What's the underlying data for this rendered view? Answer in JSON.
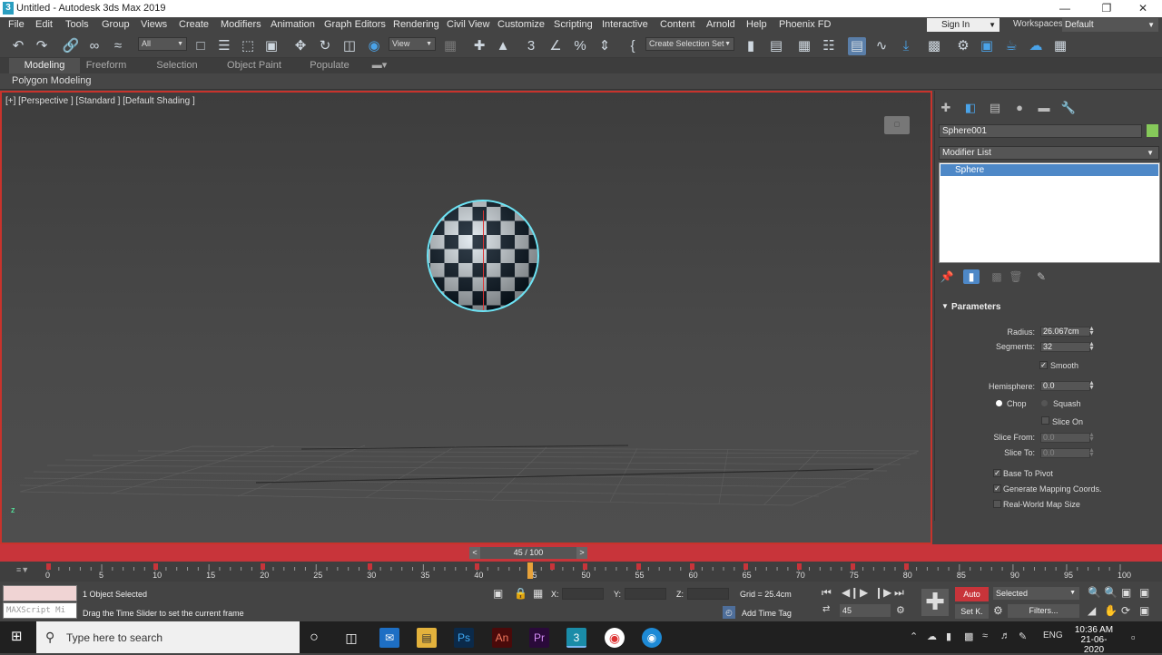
{
  "window": {
    "title": "Untitled - Autodesk 3ds Max 2019",
    "app_icon_letter": "3"
  },
  "menu": {
    "items": [
      "File",
      "Edit",
      "Tools",
      "Group",
      "Views",
      "Create",
      "Modifiers",
      "Animation",
      "Graph Editors",
      "Rendering",
      "Civil View",
      "Customize",
      "Scripting",
      "Interactive",
      "Content",
      "Arnold",
      "Help",
      "Phoenix FD"
    ],
    "sign_in": "Sign In",
    "workspaces_label": "Workspaces:",
    "workspace_value": "Default"
  },
  "toolbar": {
    "selection_filter": "All",
    "ref_coord": "View",
    "named_selection": "Create Selection Set"
  },
  "ribbon": {
    "tabs": [
      "Modeling",
      "Freeform",
      "Selection",
      "Object Paint",
      "Populate"
    ],
    "active_tab": "Modeling",
    "panel_label": "Polygon Modeling"
  },
  "viewport": {
    "label": "[+] [Perspective ] [Standard ] [Default Shading ]",
    "axis_label": "z",
    "sphere_axis_label": "z"
  },
  "command_panel": {
    "object_name": "Sphere001",
    "object_color": "#86c95a",
    "modifier_list": "Modifier List",
    "stack_item": "Sphere",
    "parameters": {
      "header": "Parameters",
      "radius_label": "Radius:",
      "radius_value": "26.067cm",
      "segments_label": "Segments:",
      "segments_value": "32",
      "smooth_label": "Smooth",
      "hemisphere_label": "Hemisphere:",
      "hemisphere_value": "0.0",
      "chop_label": "Chop",
      "squash_label": "Squash",
      "slice_on_label": "Slice On",
      "slice_from_label": "Slice From:",
      "slice_from_value": "0.0",
      "slice_to_label": "Slice To:",
      "slice_to_value": "0.0",
      "base_to_pivot_label": "Base To Pivot",
      "gen_mapping_label": "Generate Mapping Coords.",
      "real_world_label": "Real-World Map Size"
    }
  },
  "timeline": {
    "slider_text": "45 / 100",
    "prev": "<",
    "next": ">",
    "ticks": [
      "0",
      "5",
      "10",
      "15",
      "20",
      "25",
      "30",
      "35",
      "40",
      "45",
      "50",
      "55",
      "60",
      "65",
      "70",
      "75",
      "80",
      "85",
      "90",
      "95",
      "100"
    ],
    "current_frame": 45,
    "frame_count": 100,
    "keys": [
      0,
      10,
      20,
      30,
      40,
      47,
      50,
      55,
      60,
      65,
      70,
      75,
      80
    ]
  },
  "status": {
    "maxscript_placeholder": "MAXScript Mi",
    "selected_text": "1 Object Selected",
    "prompt_text": "Drag the Time Slider to set the current frame",
    "x_label": "X:",
    "y_label": "Y:",
    "z_label": "Z:",
    "grid_text": "Grid = 25.4cm",
    "add_time_tag": "Add Time Tag",
    "auto_label": "Auto",
    "setk_label": "Set K.",
    "key_filter": "Selected",
    "filters_label": "Filters...",
    "frame_value": "45"
  },
  "taskbar": {
    "search_placeholder": "Type here to search",
    "time": "10:36 AM",
    "date": "21-06-2020",
    "language": "ENG",
    "apps": [
      "Ps",
      "An",
      "Pr",
      "3"
    ]
  }
}
